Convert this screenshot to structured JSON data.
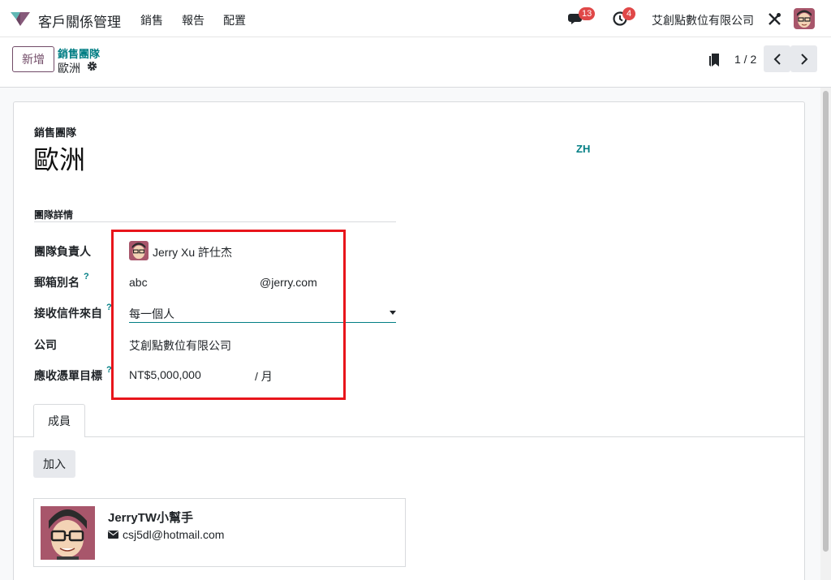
{
  "navbar": {
    "app_name": "客戶關係管理",
    "menu": [
      "銷售",
      "報告",
      "配置"
    ],
    "chat_count": "13",
    "activity_count": "4",
    "company": "艾創點數位有限公司",
    "brand_color": "#714b67"
  },
  "control_panel": {
    "new_button": "新增",
    "breadcrumb_parent": "銷售團隊",
    "breadcrumb_current": "歐洲",
    "pager": "1 / 2"
  },
  "form": {
    "record_label": "銷售團隊",
    "record_title": "歐洲",
    "language": "ZH",
    "group_title": "團隊詳情",
    "fields": {
      "leader_label": "團隊負責人",
      "leader_value": "Jerry Xu 許仕杰",
      "alias_label": "郵箱別名",
      "alias_name": "abc",
      "alias_domain": "@jerry.com",
      "alias_contact_label": "接收信件來自",
      "alias_contact_value": "每一個人",
      "company_label": "公司",
      "company_value": "艾創點數位有限公司",
      "target_label": "應收憑單目標",
      "target_value": "NT$5,000,000",
      "target_unit": "/ 月",
      "help_mark": "?"
    }
  },
  "tabs": [
    "成員"
  ],
  "members": {
    "add_button": "加入",
    "items": [
      {
        "name": "JerryTW小幫手",
        "email": "csj5dl@hotmail.com"
      }
    ]
  },
  "colors": {
    "accent": "#017e84",
    "highlight": "#e8151b",
    "badge": "#e04848"
  }
}
